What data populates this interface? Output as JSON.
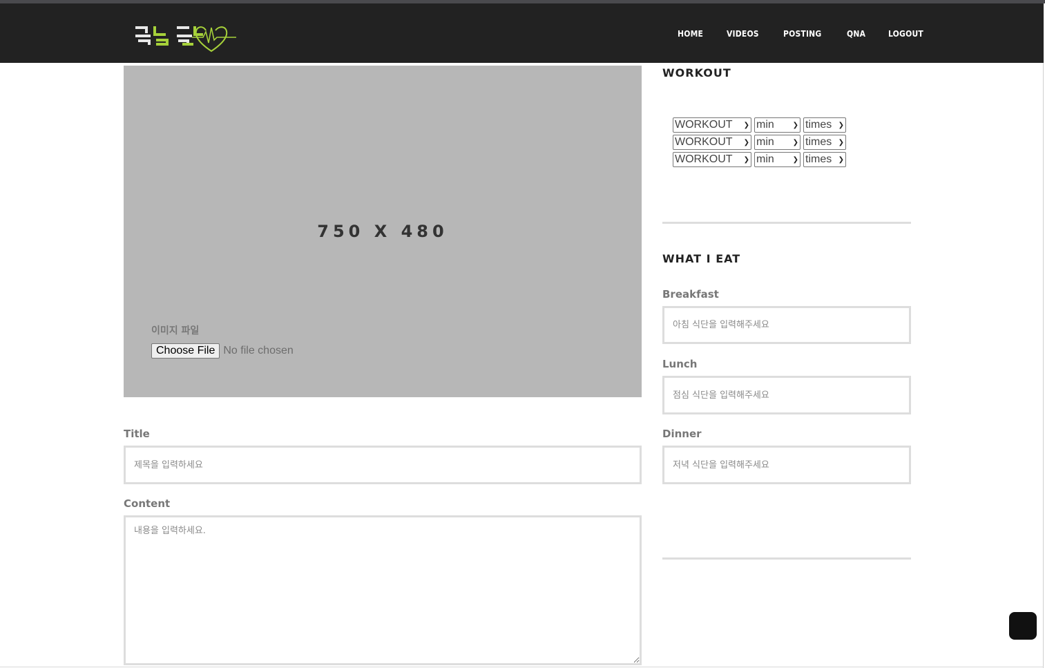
{
  "nav": {
    "logo_text": "두근두근",
    "links": [
      "HOME",
      "VIDEOS",
      "POSTING",
      "QNA",
      "LOGOUT"
    ]
  },
  "image_upload": {
    "placeholder_size": "750 X 480",
    "label": "이미지 파일",
    "button": "Choose File",
    "status": "No file chosen"
  },
  "post": {
    "title_label": "Title",
    "title_placeholder": "제목을 입력하세요",
    "content_label": "Content",
    "content_placeholder": "내용을 입력하세요."
  },
  "workout": {
    "heading": "WORKOUT",
    "rows": [
      {
        "workout": "WORKOUT",
        "min": "min",
        "times": "times"
      },
      {
        "workout": "WORKOUT",
        "min": "min",
        "times": "times"
      },
      {
        "workout": "WORKOUT",
        "min": "min",
        "times": "times"
      }
    ]
  },
  "meals": {
    "heading": "WHAT I EAT",
    "breakfast_label": "Breakfast",
    "breakfast_placeholder": "아침 식단을 입력해주세요",
    "lunch_label": "Lunch",
    "lunch_placeholder": "점심 식단을 입력해주세요",
    "dinner_label": "Dinner",
    "dinner_placeholder": "저녁 식단을 입력해주세요"
  },
  "colors": {
    "navbar": "#222222",
    "logo_accent": "#a6d13a",
    "placeholder_bg": "#b7b7b7"
  }
}
